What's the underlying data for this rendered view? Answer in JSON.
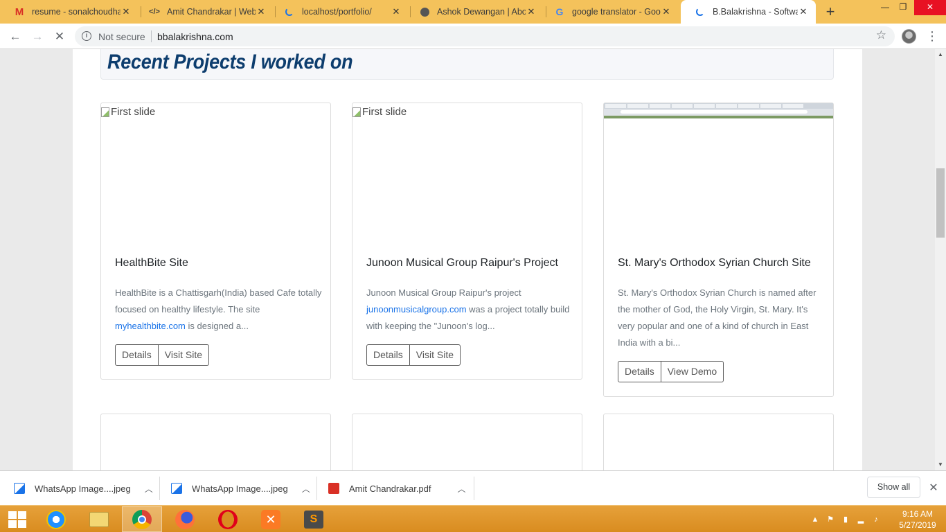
{
  "browser": {
    "tabs": [
      {
        "title": "resume - sonalchoudhar",
        "favicon": "gmail-icon"
      },
      {
        "title": "Amit Chandrakar | Web D",
        "favicon": "code-icon"
      },
      {
        "title": "localhost/portfolio/",
        "favicon": "loading-icon"
      },
      {
        "title": "Ashok Dewangan | Abou",
        "favicon": "globe-icon"
      },
      {
        "title": "google translator - Goog",
        "favicon": "google-icon"
      },
      {
        "title": "B.Balakrishna - Software",
        "favicon": "loading-icon",
        "active": true
      }
    ],
    "security_label": "Not secure",
    "url": "bbalakrishna.com"
  },
  "page": {
    "section_title": "Recent Projects I worked on",
    "projects": [
      {
        "image_alt": "First slide",
        "title": "HealthBite Site",
        "desc_before": "HealthBite is a Chattisgarh(India) based Cafe totally focused on healthy lifestyle. The site ",
        "link": "myhealthbite.com",
        "desc_after": " is designed a...",
        "buttons": [
          "Details",
          "Visit Site"
        ]
      },
      {
        "image_alt": "First slide",
        "title": "Junoon Musical Group Raipur's Project",
        "desc_before": "Junoon Musical Group Raipur's project ",
        "link": "junoonmusicalgroup.com",
        "desc_after": " was a project totally build with keeping the \"Junoon's log...",
        "buttons": [
          "Details",
          "Visit Site"
        ]
      },
      {
        "image_alt": "",
        "title": "St. Mary's Orthodox Syrian Church Site",
        "desc_before": "St. Mary's Orthodox Syrian Church is named after the mother of God, the Holy Virgin, St. Mary. It's very popular and one of a kind of church in East India with a bi...",
        "link": "",
        "desc_after": "",
        "buttons": [
          "Details",
          "View Demo"
        ]
      }
    ]
  },
  "downloads": {
    "items": [
      {
        "name": "WhatsApp Image....jpeg",
        "type": "image"
      },
      {
        "name": "WhatsApp Image....jpeg",
        "type": "image"
      },
      {
        "name": "Amit Chandrakar.pdf",
        "type": "pdf"
      }
    ],
    "show_all": "Show all"
  },
  "taskbar": {
    "time": "9:16 AM",
    "date": "5/27/2019"
  },
  "colors": {
    "tabstrip": "#f4c25b",
    "heading": "#0d3d6e",
    "link": "#1a73e8",
    "taskbar": "#d98c20"
  }
}
